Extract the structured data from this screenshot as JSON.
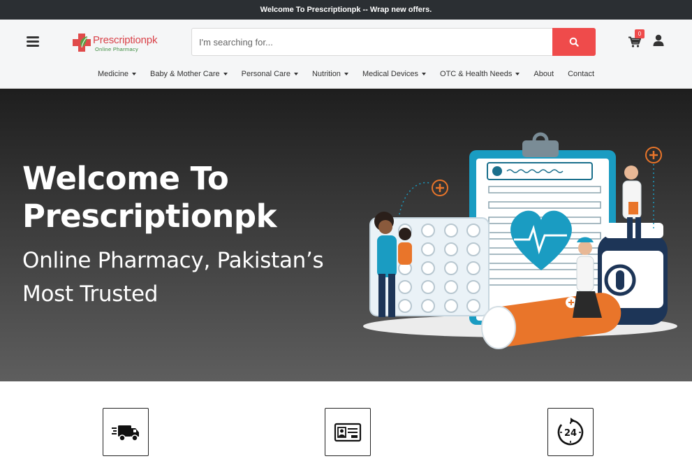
{
  "topbar": {
    "text": "Welcome To Prescriptionpk -- Wrap new offers."
  },
  "header": {
    "logo": {
      "name": "Prescriptionpk",
      "tagline": "Online Pharmacy"
    },
    "search": {
      "placeholder": "I'm searching for..."
    },
    "cart": {
      "count": "0"
    }
  },
  "nav": {
    "items": [
      {
        "label": "Medicine",
        "dropdown": true
      },
      {
        "label": "Baby & Mother Care",
        "dropdown": true
      },
      {
        "label": "Personal Care",
        "dropdown": true
      },
      {
        "label": "Nutrition",
        "dropdown": true
      },
      {
        "label": "Medical Devices",
        "dropdown": true
      },
      {
        "label": "OTC & Health Needs",
        "dropdown": true
      },
      {
        "label": "About",
        "dropdown": false
      },
      {
        "label": "Contact",
        "dropdown": false
      }
    ]
  },
  "hero": {
    "title_line1": "Welcome To",
    "title_line2": "Prescriptionpk",
    "sub_line1": "Online Pharmacy, Pakistan’s",
    "sub_line2": "Most Trusted"
  },
  "features": [
    {
      "icon": "delivery-truck-icon"
    },
    {
      "icon": "prescription-card-icon"
    },
    {
      "icon": "24-hours-icon",
      "label": "24"
    }
  ],
  "colors": {
    "accent": "#ef4b4b",
    "topbar": "#2b2f33",
    "teal": "#1a9cc2",
    "orange": "#e9752a"
  }
}
